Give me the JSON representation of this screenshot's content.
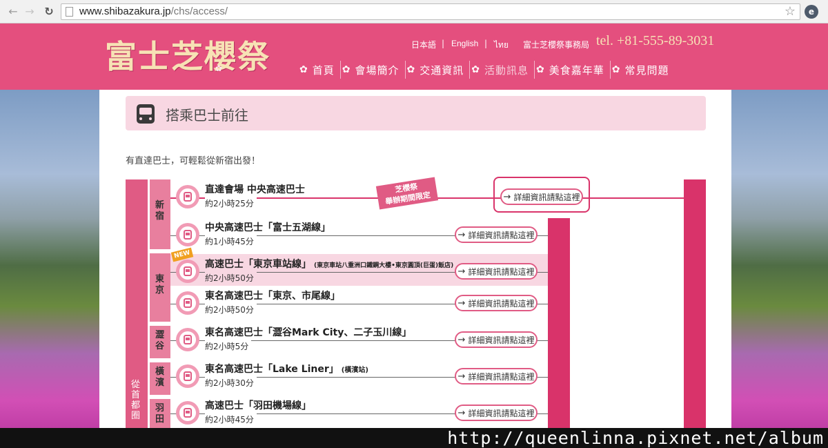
{
  "browser": {
    "url_host": "www.shibazakura.jp",
    "url_path": "/chs/access/"
  },
  "header": {
    "logo": "富士芝櫻祭",
    "lang_ja": "日本語",
    "lang_en": "English",
    "lang_th": "ไทย",
    "office": "富士芝櫻祭事務局",
    "tel": "tel. +81-555-89-3031",
    "nav": [
      {
        "label": "首頁"
      },
      {
        "label": "會場簡介"
      },
      {
        "label": "交通資訊"
      },
      {
        "label": "活動訊息"
      },
      {
        "label": "美食嘉年華"
      },
      {
        "label": "常見問題"
      }
    ]
  },
  "section": {
    "title": "搭乘巴士前往",
    "intro": "有直達巴士，可輕鬆從新宿出發！"
  },
  "diagram": {
    "outer_label": "從首都圈",
    "festival_badge_line1": "芝櫻祭",
    "festival_badge_line2": "舉辦期間限定",
    "new_badge": "NEW",
    "groups": [
      {
        "label": "新宿"
      },
      {
        "label": "東京"
      },
      {
        "label": "澀谷"
      },
      {
        "label": "橫濱"
      },
      {
        "label": "羽田"
      }
    ],
    "routes": [
      {
        "name": "直達會場 中央高速巴士",
        "note": "",
        "time": "約2小時25分",
        "button": "詳細資訊請點這裡"
      },
      {
        "name": "中央高速巴士「富士五湖線」",
        "note": "",
        "time": "約1小時45分",
        "button": "詳細資訊請點這裡"
      },
      {
        "name": "高速巴士「東京車站線」",
        "note": "(東京車站八重洲口鐵鋼大樓•東京圓頂(巨蛋)飯店)",
        "time": "約2小時50分",
        "button": "詳細資訊請點這裡"
      },
      {
        "name": "東名高速巴士「東京、市尾線」",
        "note": "",
        "time": "約2小時50分",
        "button": "詳細資訊請點這裡"
      },
      {
        "name": "東名高速巴士「澀谷Mark City、二子玉川線」",
        "note": "",
        "time": "約2小時5分",
        "button": "詳細資訊請點這裡"
      },
      {
        "name": "東名高速巴士「Lake Liner」",
        "note": "(橫濱站)",
        "time": "約2小時30分",
        "button": "詳細資訊請點這裡"
      },
      {
        "name": "高速巴士「羽田機場線」",
        "note": "",
        "time": "約2小時45分",
        "button": "詳細資訊請點這裡"
      }
    ]
  },
  "watermark": "http://queenlinna.pixnet.net/album",
  "colors": {
    "header_pink": "#e44f7e",
    "accent": "#d9336a",
    "section_bg": "#f8d7e2"
  }
}
